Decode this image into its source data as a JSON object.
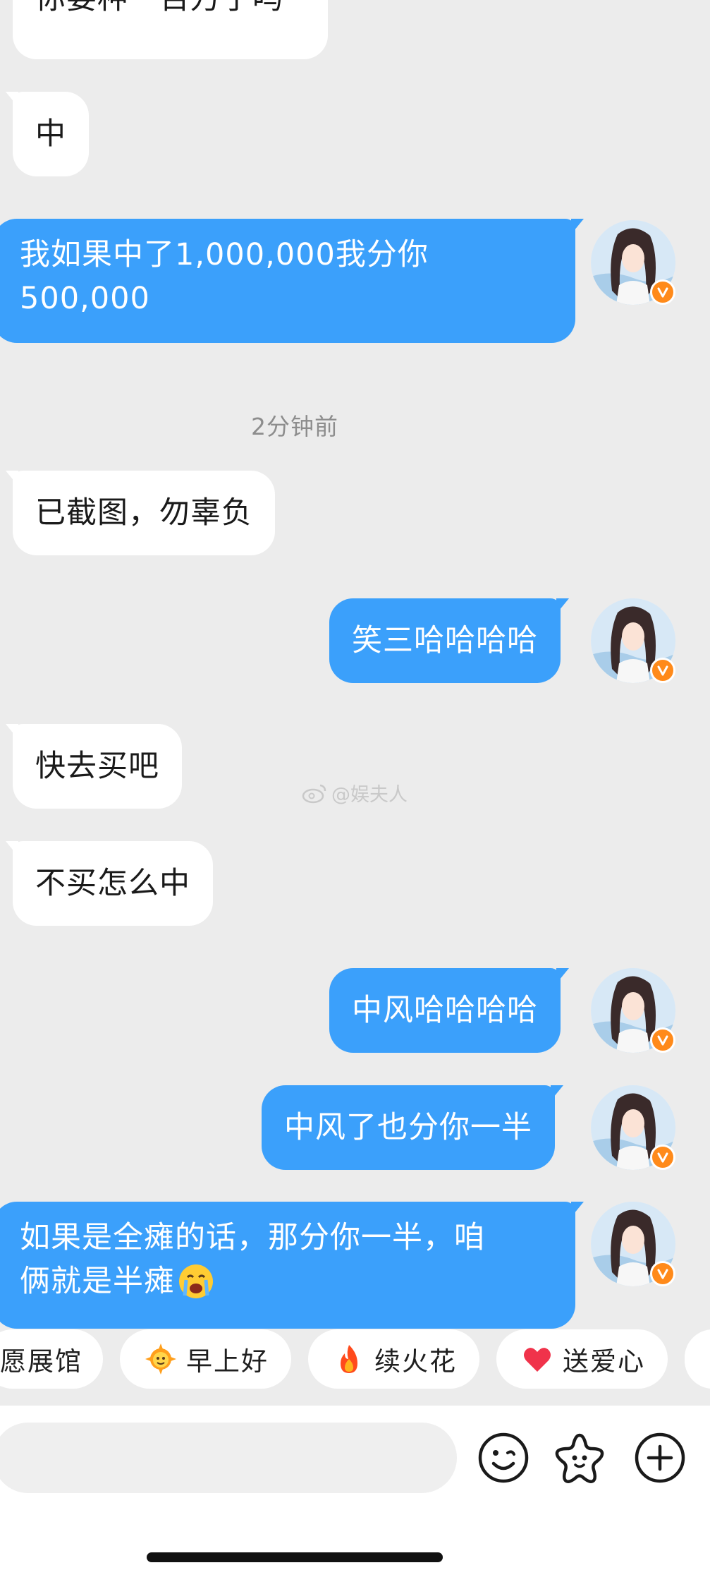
{
  "messages": [
    {
      "dir": "in",
      "text": "你要种一百万了吗"
    },
    {
      "dir": "in",
      "text": "中"
    },
    {
      "dir": "out",
      "lines": [
        "我如果中了1,000,000我分你",
        "500,000"
      ]
    },
    {
      "timestamp": "2分钟前"
    },
    {
      "dir": "in",
      "text": "已截图，勿辜负"
    },
    {
      "dir": "out",
      "text": "笑三哈哈哈哈"
    },
    {
      "dir": "in",
      "text": "快去买吧"
    },
    {
      "dir": "in",
      "text": "不买怎么中"
    },
    {
      "dir": "out",
      "text": "中风哈哈哈哈"
    },
    {
      "dir": "out",
      "text": "中风了也分你一半"
    },
    {
      "dir": "out",
      "lines": [
        "如果是全瘫的话，那分你一半，咱",
        "俩就是半瘫"
      ],
      "emoji": "crying-face-icon"
    }
  ],
  "watermark": "@娱夫人",
  "quick_replies": [
    {
      "label": "愿展馆",
      "icon": ""
    },
    {
      "label": "早上好",
      "icon": "sun-face-icon"
    },
    {
      "label": "续火花",
      "icon": "fire-icon"
    },
    {
      "label": "送爱心",
      "icon": "heart-icon"
    }
  ],
  "input": {
    "placeholder": ""
  },
  "toolbar": {
    "icons": [
      "smile-emoji-icon",
      "star-sticker-icon",
      "plus-icon"
    ]
  },
  "colors": {
    "outgoing_bubble": "#3ba0fb",
    "incoming_bubble": "#ffffff",
    "background": "#ececec",
    "badge": "#ff8a1a"
  }
}
